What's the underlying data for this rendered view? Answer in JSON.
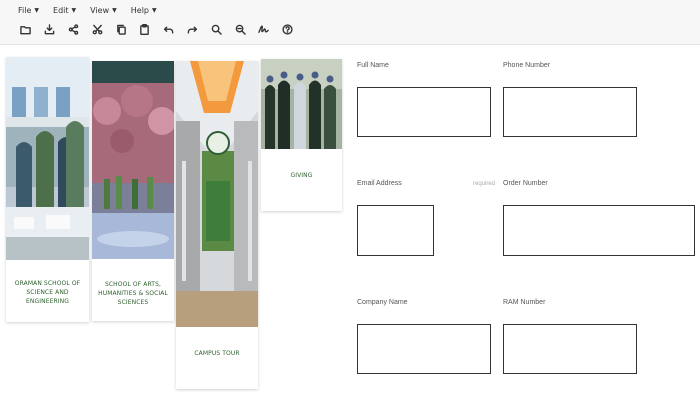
{
  "menu": {
    "items": [
      {
        "label": "File"
      },
      {
        "label": "Edit"
      },
      {
        "label": "View"
      },
      {
        "label": "Help"
      }
    ]
  },
  "toolbar": {
    "icons": [
      "folder-icon",
      "download-icon",
      "share-icon",
      "cut-icon",
      "copy-icon",
      "clipboard-icon",
      "undo-icon",
      "redo-icon",
      "zoom-in-icon",
      "zoom-out-icon",
      "signature-icon",
      "help-icon"
    ]
  },
  "cards": [
    {
      "caption": "ORAMAN SCHOOL OF SCIENCE AND ENGINEERING"
    },
    {
      "caption": "SCHOOL OF ARTS, HUMANITIES & SOCIAL SCIENCES"
    },
    {
      "caption": "CAMPUS TOUR"
    },
    {
      "caption": "GIVING"
    }
  ],
  "form": {
    "full_name_label": "Full Name",
    "phone_label": "Phone Number",
    "email_label": "Email Address",
    "email_hint": "required",
    "order_label": "Order Number",
    "company_label": "Company Name",
    "ram_label": "RAM Number"
  },
  "colors": {
    "caption_green": "#2d5f2d",
    "toolbar_bg": "#f7f7f7"
  }
}
